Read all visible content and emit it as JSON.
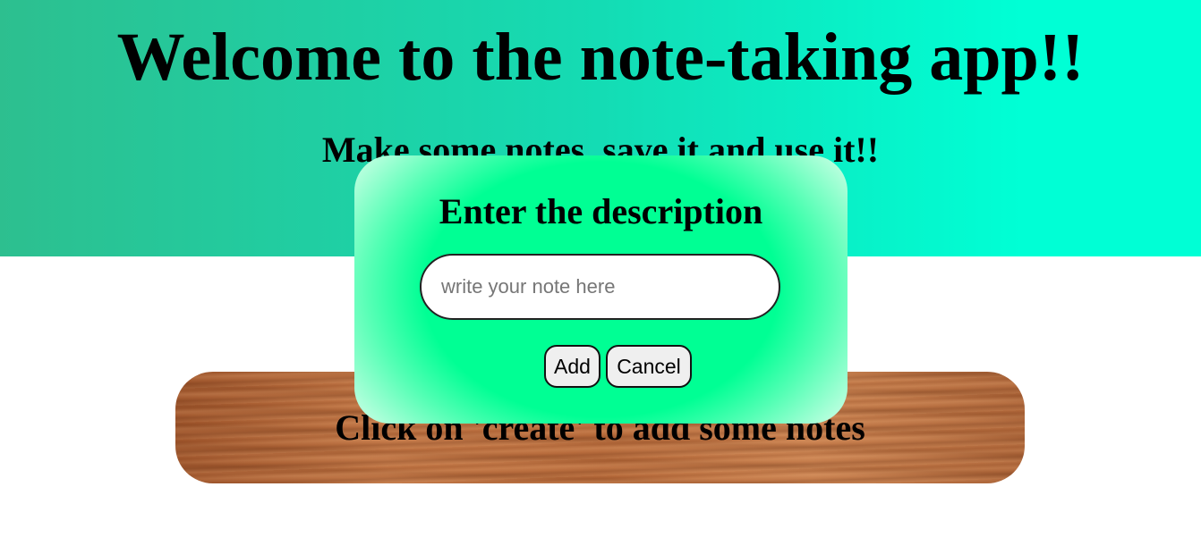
{
  "header": {
    "title": "Welcome to the note-taking app!!",
    "subtitle": "Make some notes, save it and use it!!"
  },
  "notes_area": {
    "empty_message": "Click on 'create' to add some notes"
  },
  "modal": {
    "title": "Enter the description",
    "input": {
      "value": "",
      "placeholder": "write your note here"
    },
    "add_label": "Add",
    "cancel_label": "Cancel"
  },
  "colors": {
    "header_left": "#2dbf8f",
    "header_right": "#00ffd5",
    "modal_center": "#00ff94",
    "board_wood": "#c27645"
  }
}
